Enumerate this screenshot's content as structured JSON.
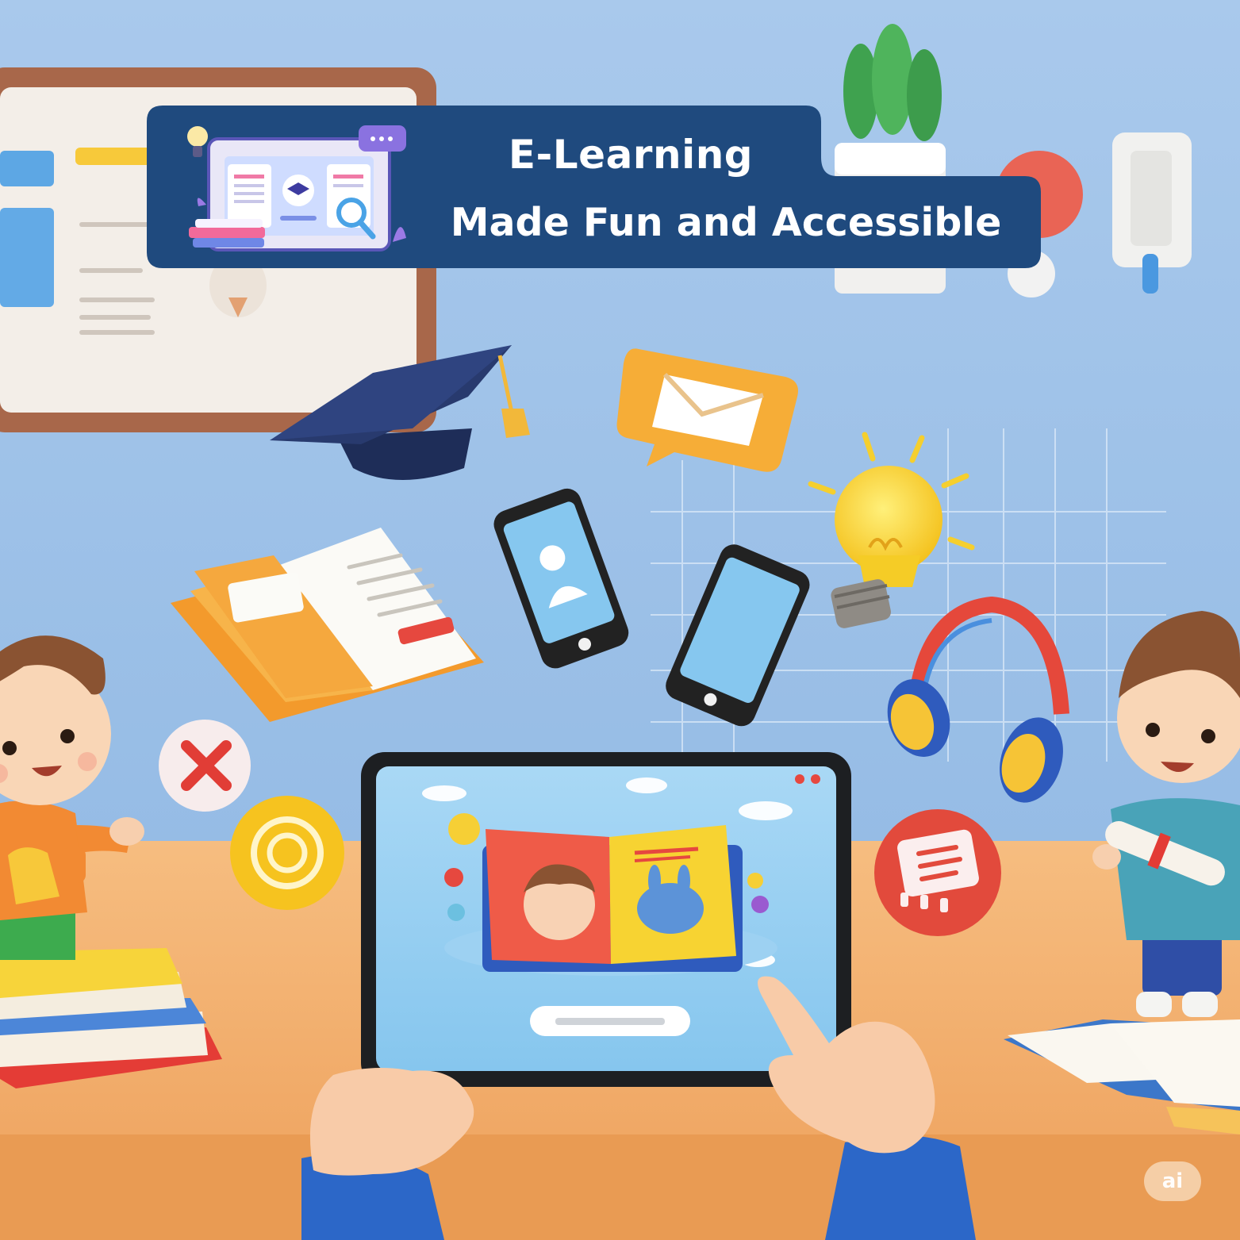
{
  "banner": {
    "title_line1": "E-Learning",
    "title_line2": "Made Fun and Accessible"
  },
  "watermark": {
    "label": "ai"
  },
  "colors": {
    "wall": "#9fc2e6",
    "banner": "#1f4a7e",
    "desk": "#f2b170",
    "accent_orange": "#f5a23c",
    "accent_red": "#e7473c",
    "accent_yellow": "#f8cf2e"
  },
  "icons": [
    "graduation-cap-icon",
    "chat-envelope-icon",
    "open-book-icon",
    "smartphone-icon",
    "lightbulb-icon",
    "headphones-icon",
    "close-x-icon",
    "target-icon",
    "document-icon",
    "tablet-icon",
    "laptop-elearning-icon"
  ]
}
